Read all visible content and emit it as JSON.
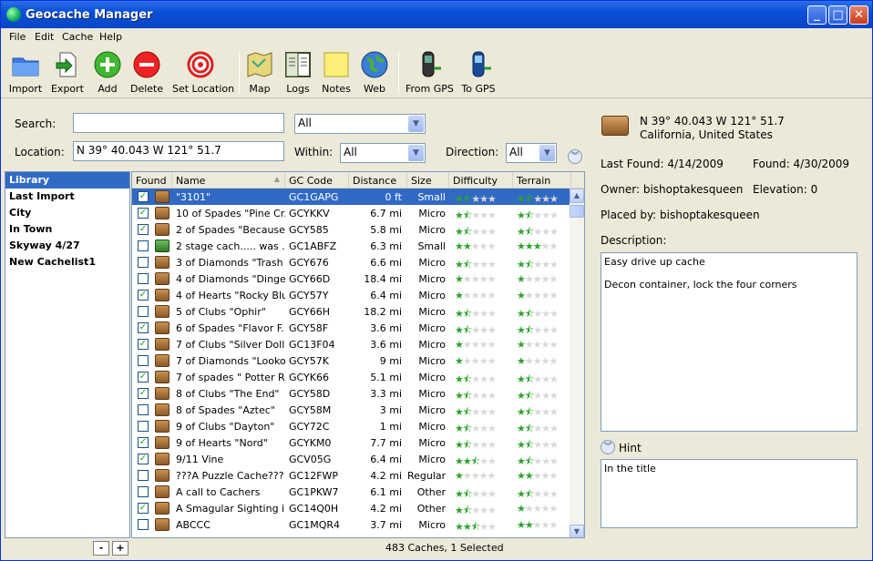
{
  "window": {
    "title": "Geocache Manager"
  },
  "menu": [
    "File",
    "Edit",
    "Cache",
    "Help"
  ],
  "toolbar": {
    "import": "Import",
    "export": "Export",
    "add": "Add",
    "delete": "Delete",
    "set_location": "Set Location",
    "map": "Map",
    "logs": "Logs",
    "notes": "Notes",
    "web": "Web",
    "from_gps": "From GPS",
    "to_gps": "To GPS"
  },
  "search": {
    "search_label": "Search:",
    "search_value": "",
    "filter_value": "All",
    "location_label": "Location:",
    "location_value": "N 39° 40.043  W 121° 51.7",
    "within_label": "Within:",
    "within_value": "All",
    "direction_label": "Direction:",
    "direction_value": "All"
  },
  "sidebar": [
    "Library",
    "Last Import",
    "City",
    "In Town",
    "Skyway 4/27",
    "New Cachelist1"
  ],
  "columns": [
    "Found",
    "Name",
    "GC Code",
    "Distance",
    "Size",
    "Difficulty",
    "Terrain"
  ],
  "rows": [
    {
      "found": true,
      "name": "\"3101\"",
      "code": "GC1GAPG",
      "dist": "0 ft",
      "size": "Small",
      "diff": 1.5,
      "terr": 1.5
    },
    {
      "found": true,
      "name": "10 of Spades \"Pine Cr...",
      "code": "GCYKKV",
      "dist": "6.7 mi",
      "size": "Micro",
      "diff": 1.5,
      "terr": 1.5
    },
    {
      "found": true,
      "name": "2 of Spades \"Because ...",
      "code": "GCY585",
      "dist": "5.8 mi",
      "size": "Micro",
      "diff": 1.5,
      "terr": 1.5
    },
    {
      "found": false,
      "name": "2 stage cach..... was ...",
      "code": "GC1ABFZ",
      "dist": "6.3 mi",
      "size": "Small",
      "diff": 2,
      "terr": 3,
      "green": true
    },
    {
      "found": false,
      "name": "3 of Diamonds \"Trash ...",
      "code": "GCY676",
      "dist": "6.6 mi",
      "size": "Micro",
      "diff": 1.5,
      "terr": 1.5
    },
    {
      "found": false,
      "name": "4 of Diamonds \"Dinger...",
      "code": "GCY66D",
      "dist": "18.4 mi",
      "size": "Micro",
      "diff": 1,
      "terr": 1
    },
    {
      "found": true,
      "name": "4 of Hearts \"Rocky Bluff\"",
      "code": "GCY57Y",
      "dist": "6.4 mi",
      "size": "Micro",
      "diff": 1,
      "terr": 1
    },
    {
      "found": false,
      "name": "5 of Clubs \"Ophir\"",
      "code": "GCY66H",
      "dist": "18.2 mi",
      "size": "Micro",
      "diff": 1.5,
      "terr": 1.5
    },
    {
      "found": true,
      "name": "6 of Spades \"Flavor F...",
      "code": "GCY58F",
      "dist": "3.6 mi",
      "size": "Micro",
      "diff": 1.5,
      "terr": 1.5
    },
    {
      "found": true,
      "name": "7 of Clubs \"Silver Dolla...",
      "code": "GC13F04",
      "dist": "3.6 mi",
      "size": "Micro",
      "diff": 1,
      "terr": 1
    },
    {
      "found": false,
      "name": "7 of Diamonds \"Looko...",
      "code": "GCY57K",
      "dist": "9 mi",
      "size": "Micro",
      "diff": 1,
      "terr": 1
    },
    {
      "found": true,
      "name": "7 of spades \" Potter R...",
      "code": "GCYK66",
      "dist": "5.1 mi",
      "size": "Micro",
      "diff": 1.5,
      "terr": 1.5
    },
    {
      "found": true,
      "name": "8 of Clubs \"The End\"",
      "code": "GCY58D",
      "dist": "3.3 mi",
      "size": "Micro",
      "diff": 1.5,
      "terr": 1.5
    },
    {
      "found": false,
      "name": "8 of Spades \"Aztec\"",
      "code": "GCY58M",
      "dist": "3 mi",
      "size": "Micro",
      "diff": 1.5,
      "terr": 1.5
    },
    {
      "found": false,
      "name": "9 of Clubs \"Dayton\"",
      "code": "GCY72C",
      "dist": "1 mi",
      "size": "Micro",
      "diff": 1.5,
      "terr": 1.5
    },
    {
      "found": true,
      "name": "9 of Hearts \"Nord\"",
      "code": "GCYKM0",
      "dist": "7.7 mi",
      "size": "Micro",
      "diff": 1.5,
      "terr": 1.5
    },
    {
      "found": true,
      "name": "9/11 Vine",
      "code": "GCV05G",
      "dist": "6.4 mi",
      "size": "Micro",
      "diff": 2.5,
      "terr": 1.5
    },
    {
      "found": false,
      "name": "???A Puzzle Cache???",
      "code": "GC12FWP",
      "dist": "4.2 mi",
      "size": "Regular",
      "diff": 1,
      "terr": 2
    },
    {
      "found": false,
      "name": "A call to Cachers",
      "code": "GC1PKW7",
      "dist": "6.1 mi",
      "size": "Other",
      "diff": 1.5,
      "terr": 1.5
    },
    {
      "found": true,
      "name": "A Smagular Sighting in...",
      "code": "GC14Q0H",
      "dist": "4.2 mi",
      "size": "Other",
      "diff": 1.5,
      "terr": 1
    },
    {
      "found": false,
      "name": "ABCCC",
      "code": "GC1MQR4",
      "dist": "3.7 mi",
      "size": "Micro",
      "diff": 2.5,
      "terr": 2
    }
  ],
  "status": {
    "text": "483 Caches, 1 Selected",
    "minus": "-",
    "plus": "+"
  },
  "details": {
    "coords": "N 39° 40.043  W 121° 51.7",
    "region": "California, United States",
    "last_found": "Last Found: 4/14/2009",
    "found": "Found: 4/30/2009",
    "owner": "Owner: bishoptakesqueen",
    "elevation": "Elevation: 0",
    "placed_by": "Placed by: bishoptakesqueen",
    "description_label": "Description:",
    "description_line1": "Easy drive up cache",
    "description_line2": "Decon container, lock the four corners",
    "hint_label": "Hint",
    "hint_text": "In the title"
  }
}
